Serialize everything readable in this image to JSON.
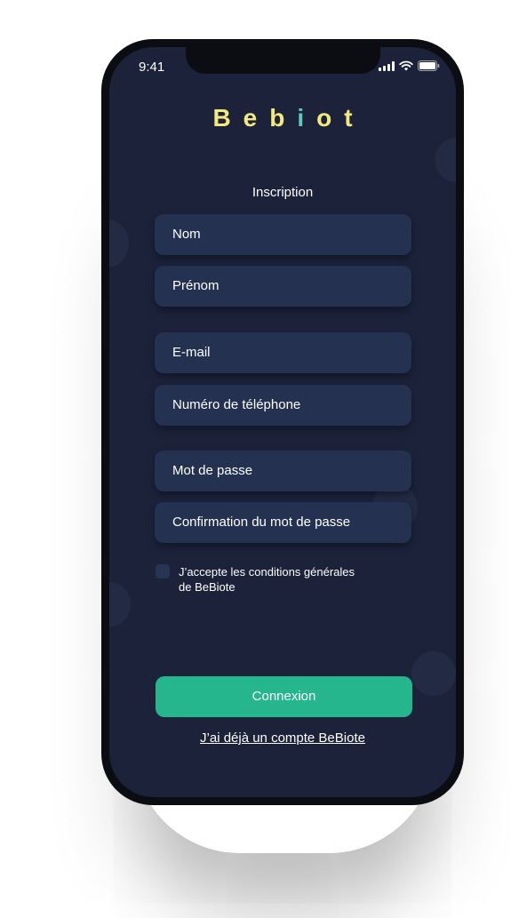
{
  "status_bar": {
    "time": "9:41"
  },
  "logo": {
    "part1": "Beb",
    "part2": "i",
    "part3": "ot"
  },
  "page_title": "Inscription",
  "form": {
    "fields": [
      {
        "placeholder": "Nom"
      },
      {
        "placeholder": "Prénom"
      },
      {
        "placeholder": "E-mail"
      },
      {
        "placeholder": "Numéro de téléphone"
      },
      {
        "placeholder": "Mot de passe"
      },
      {
        "placeholder": "Confirmation du mot de passe"
      }
    ],
    "terms_label_line1": "J’accepte les conditions générales",
    "terms_label_line2": "de BeBiote",
    "submit_label": "Connexion",
    "login_link": "J’ai déjà un compte BeBiote"
  },
  "colors": {
    "background": "#1b223a",
    "field": "#253150",
    "accent": "#25b68e",
    "logo": "#f3e97c"
  }
}
